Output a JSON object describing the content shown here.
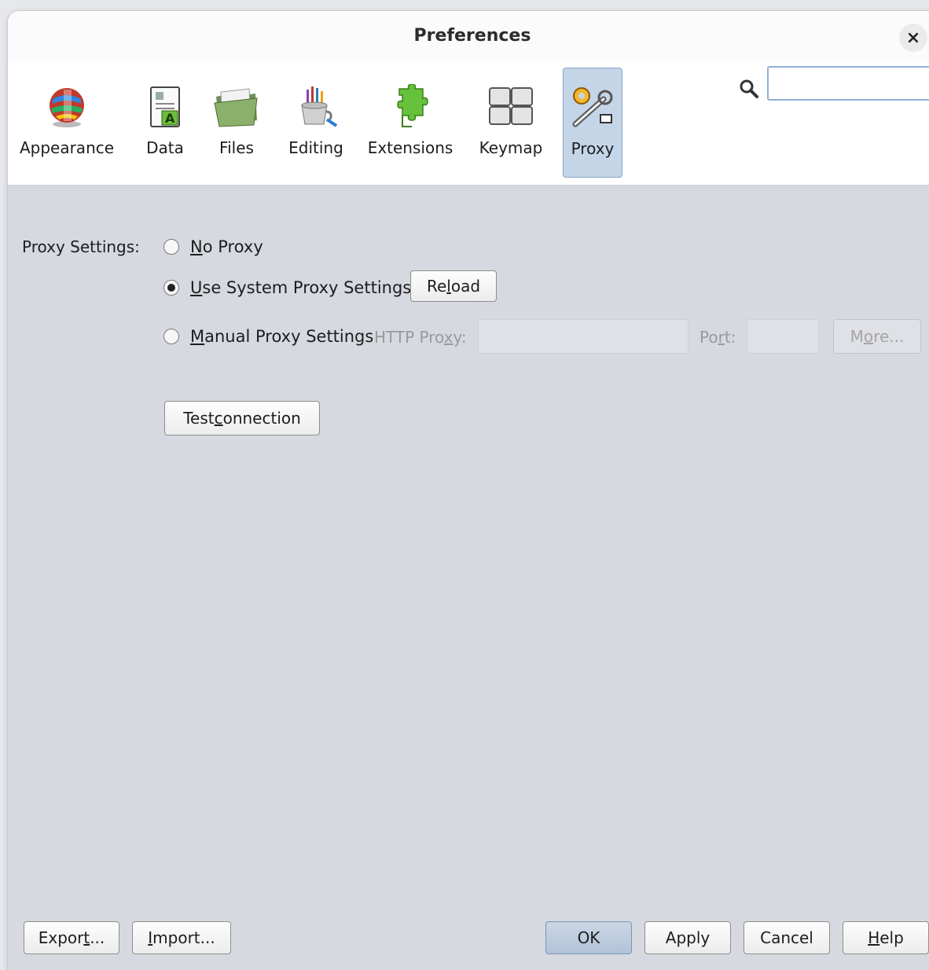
{
  "window": {
    "title": "Preferences",
    "close_label": "×"
  },
  "toolbar": {
    "categories": [
      {
        "label": "Appearance",
        "icon": "globe-icon",
        "active": false
      },
      {
        "label": "Data",
        "icon": "data-document-icon",
        "active": false
      },
      {
        "label": "Files",
        "icon": "folder-icon",
        "active": false
      },
      {
        "label": "Editing",
        "icon": "brush-cup-icon",
        "active": false
      },
      {
        "label": "Extensions",
        "icon": "puzzle-piece-icon",
        "active": false
      },
      {
        "label": "Keymap",
        "icon": "keyboard-keys-icon",
        "active": false
      },
      {
        "label": "Proxy",
        "icon": "wrench-gear-icon",
        "active": true
      }
    ],
    "search": {
      "value": "",
      "placeholder": ""
    }
  },
  "proxy": {
    "settings_label": "Proxy Settings:",
    "options": [
      {
        "mnemonic": "N",
        "rest": "o Proxy",
        "selected": false
      },
      {
        "mnemonic": "U",
        "rest": "se System Proxy Settings",
        "selected": true
      },
      {
        "mnemonic": "M",
        "rest": "anual Proxy Settings",
        "selected": false
      }
    ],
    "reload": {
      "pre": "Re",
      "mnemonic": "l",
      "post": "oad"
    },
    "http_proxy_label": {
      "pre": "HTTP Pro",
      "mnemonic": "x",
      "post": "y:"
    },
    "http_proxy_value": "",
    "port_label": {
      "pre": "Po",
      "mnemonic": "r",
      "post": "t:"
    },
    "port_value": "",
    "more": {
      "pre": "M",
      "mnemonic": "o",
      "post": "re..."
    },
    "test_connection": {
      "pre": "Test ",
      "mnemonic": "c",
      "post": "onnection"
    }
  },
  "footer": {
    "export": {
      "pre": "Expor",
      "mnemonic": "t",
      "post": "..."
    },
    "import": {
      "pre": "",
      "mnemonic": "I",
      "post": "mport..."
    },
    "ok": "OK",
    "apply": "Apply",
    "cancel": "Cancel",
    "help": {
      "pre": "",
      "mnemonic": "H",
      "post": "elp"
    }
  }
}
